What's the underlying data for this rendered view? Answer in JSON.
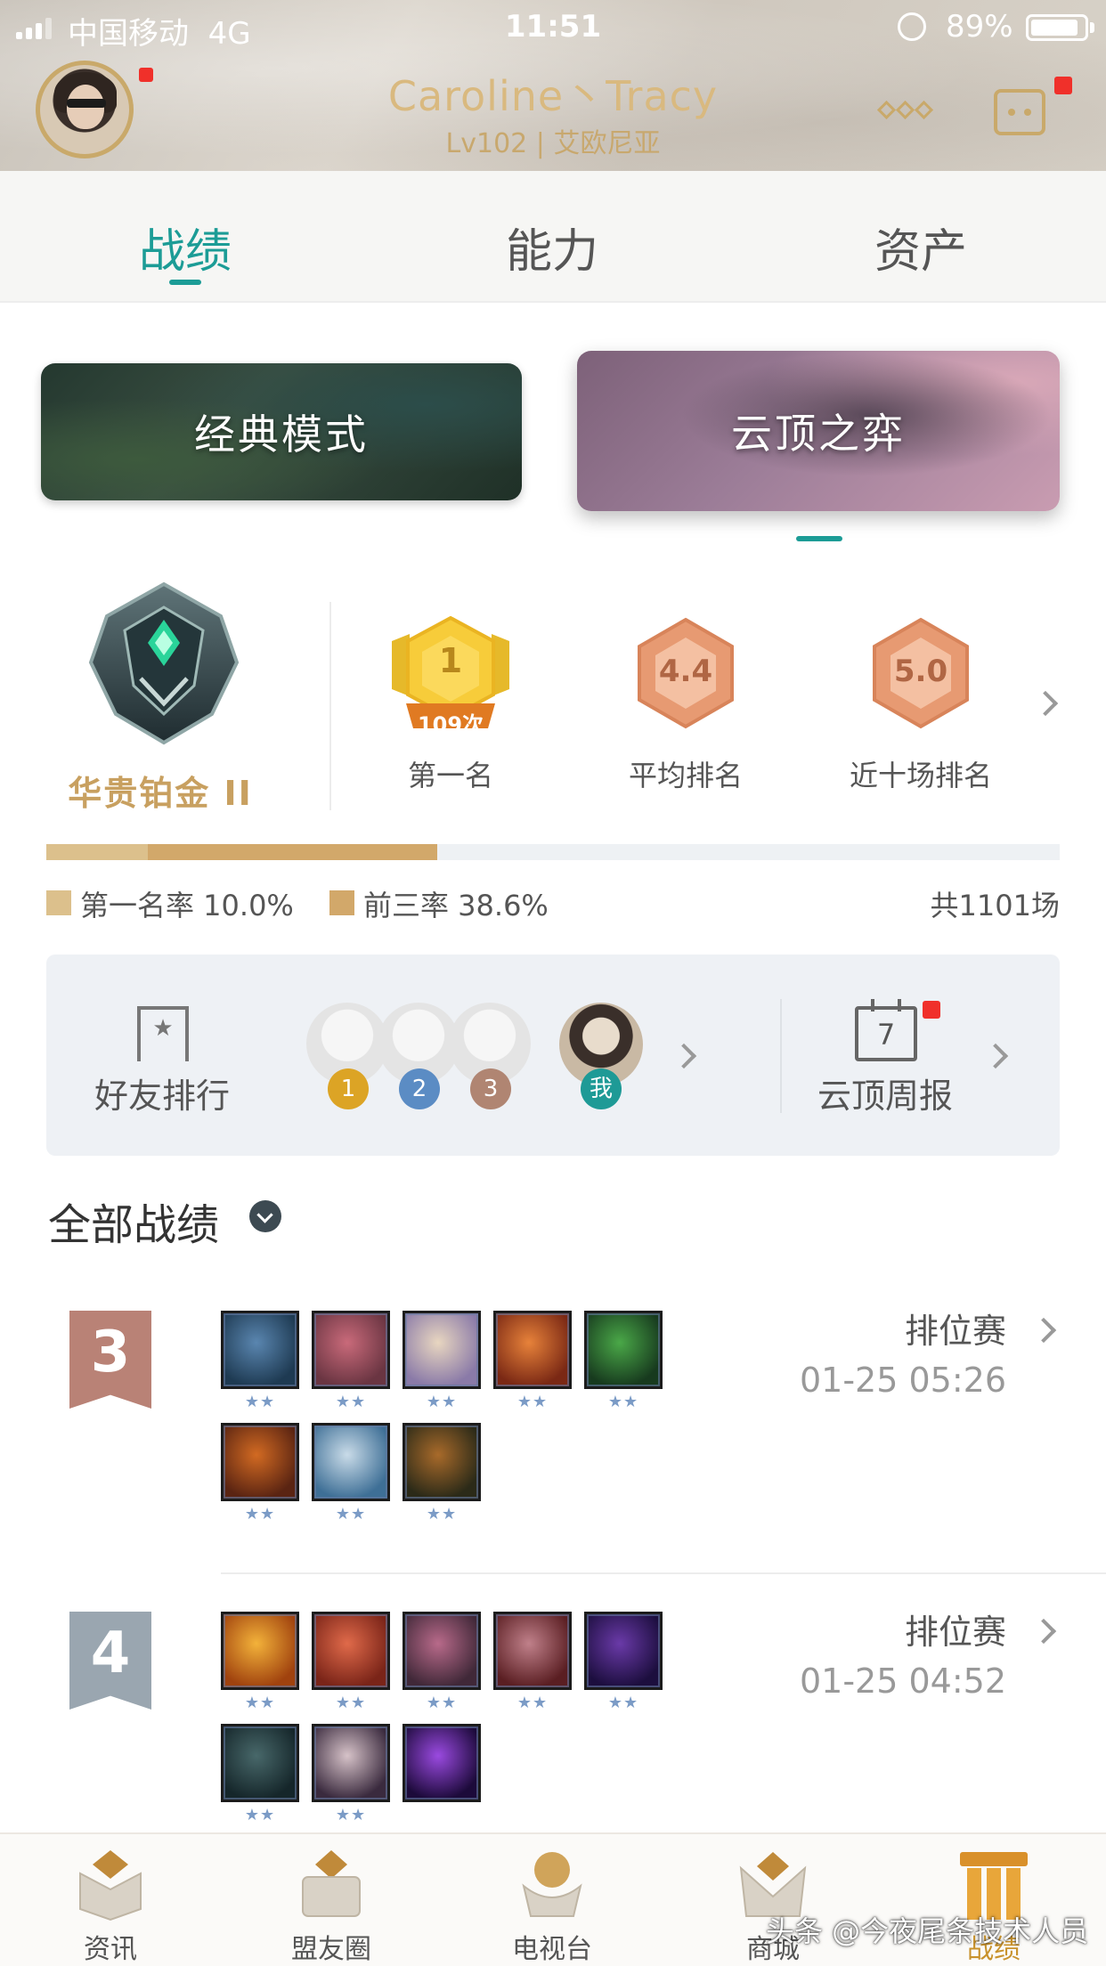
{
  "status_bar": {
    "carrier": "中国移动",
    "network": "4G",
    "time": "11:51",
    "battery": "89%",
    "battery_level": 0.89
  },
  "header": {
    "username": "Caroline丶Tracy",
    "level_region": "Lv102 | 艾欧尼亚",
    "accent_color": "#d9b97f"
  },
  "tabs": [
    {
      "label": "战绩",
      "active": true
    },
    {
      "label": "能力",
      "active": false
    },
    {
      "label": "资产",
      "active": false
    }
  ],
  "modes": [
    {
      "label": "经典模式",
      "active": false
    },
    {
      "label": "云顶之弈",
      "active": true
    }
  ],
  "rank": {
    "tier": "华贵铂金 II",
    "icon": "platinum-rank-emblem-icon"
  },
  "stats": [
    {
      "badge": "1",
      "sub": "109次",
      "label": "第一名"
    },
    {
      "badge": "4.4",
      "label": "平均排名"
    },
    {
      "badge": "5.0",
      "label": "近十场排名"
    }
  ],
  "rates": {
    "first_rate_label": "第一名率 10.0%",
    "top3_rate_label": "前三率 38.6%",
    "first_rate": 0.1,
    "top3_rate": 0.386,
    "total": "共1101场",
    "first_color": "#dcc08c",
    "top3_color": "#d2a86a"
  },
  "friend_panel": {
    "ranking_label": "好友排行",
    "friends": [
      "1",
      "2",
      "3"
    ],
    "friend_badge_colors": [
      "#dca425",
      "#5b8cc4",
      "#b08572"
    ],
    "me_label": "我",
    "weekly_label": "云顶周报",
    "calendar_day": "7"
  },
  "matches_section": {
    "title": "全部战绩"
  },
  "matches": [
    {
      "place": "3",
      "ribbon_color": "#b98276",
      "type": "排位赛",
      "time": "01-25 05:26",
      "champions": [
        {
          "icon": "champion-1-icon",
          "stars": "★★",
          "colors": [
            "#1e3a52",
            "#5a86b0"
          ]
        },
        {
          "icon": "champion-2-icon",
          "stars": "★★",
          "colors": [
            "#6a3542",
            "#c96a7a"
          ]
        },
        {
          "icon": "champion-3-icon",
          "stars": "★★",
          "colors": [
            "#8a7aa8",
            "#e8d6c0"
          ]
        },
        {
          "icon": "champion-4-icon",
          "stars": "★★",
          "colors": [
            "#7a2814",
            "#e7823a"
          ]
        },
        {
          "icon": "champion-5-icon",
          "stars": "★★",
          "colors": [
            "#173a1e",
            "#4aa848"
          ]
        },
        {
          "icon": "champion-6-icon",
          "stars": "★★",
          "colors": [
            "#5a2412",
            "#d26a22"
          ]
        },
        {
          "icon": "champion-7-icon",
          "stars": "★★",
          "colors": [
            "#3e6f96",
            "#c9dbe8"
          ]
        },
        {
          "icon": "champion-8-icon",
          "stars": "★★",
          "colors": [
            "#2b2a18",
            "#a86a2a"
          ]
        }
      ]
    },
    {
      "place": "4",
      "ribbon_color": "#9aa6b0",
      "type": "排位赛",
      "time": "01-25 04:52",
      "champions": [
        {
          "icon": "champion-9-icon",
          "stars": "★★",
          "colors": [
            "#a0420e",
            "#f3b23a"
          ]
        },
        {
          "icon": "champion-10-icon",
          "stars": "★★",
          "colors": [
            "#7a2418",
            "#e06a4a"
          ]
        },
        {
          "icon": "champion-11-icon",
          "stars": "★★",
          "colors": [
            "#402838",
            "#b86a8a"
          ]
        },
        {
          "icon": "champion-12-icon",
          "stars": "★★",
          "colors": [
            "#5a1e22",
            "#c0808a"
          ]
        },
        {
          "icon": "champion-13-icon",
          "stars": "★★",
          "colors": [
            "#1c0e3e",
            "#6a3aa8"
          ]
        },
        {
          "icon": "champion-14-icon",
          "stars": "★★",
          "colors": [
            "#15262a",
            "#48686a"
          ]
        },
        {
          "icon": "champion-15-icon",
          "stars": "★★",
          "colors": [
            "#3a2a3e",
            "#d6c2c8"
          ]
        },
        {
          "icon": "champion-16-icon",
          "stars": "",
          "colors": [
            "#1c0a3a",
            "#9a4ae0"
          ]
        }
      ]
    }
  ],
  "bottom_nav": [
    {
      "label": "资讯",
      "icon": "news-icon",
      "active": false
    },
    {
      "label": "盟友圈",
      "icon": "allies-icon",
      "active": false
    },
    {
      "label": "电视台",
      "icon": "tv-icon",
      "active": false
    },
    {
      "label": "商城",
      "icon": "store-icon",
      "active": false
    },
    {
      "label": "战绩",
      "icon": "record-icon",
      "active": true
    }
  ],
  "watermark": "头条 @今夜尾条技术人员"
}
